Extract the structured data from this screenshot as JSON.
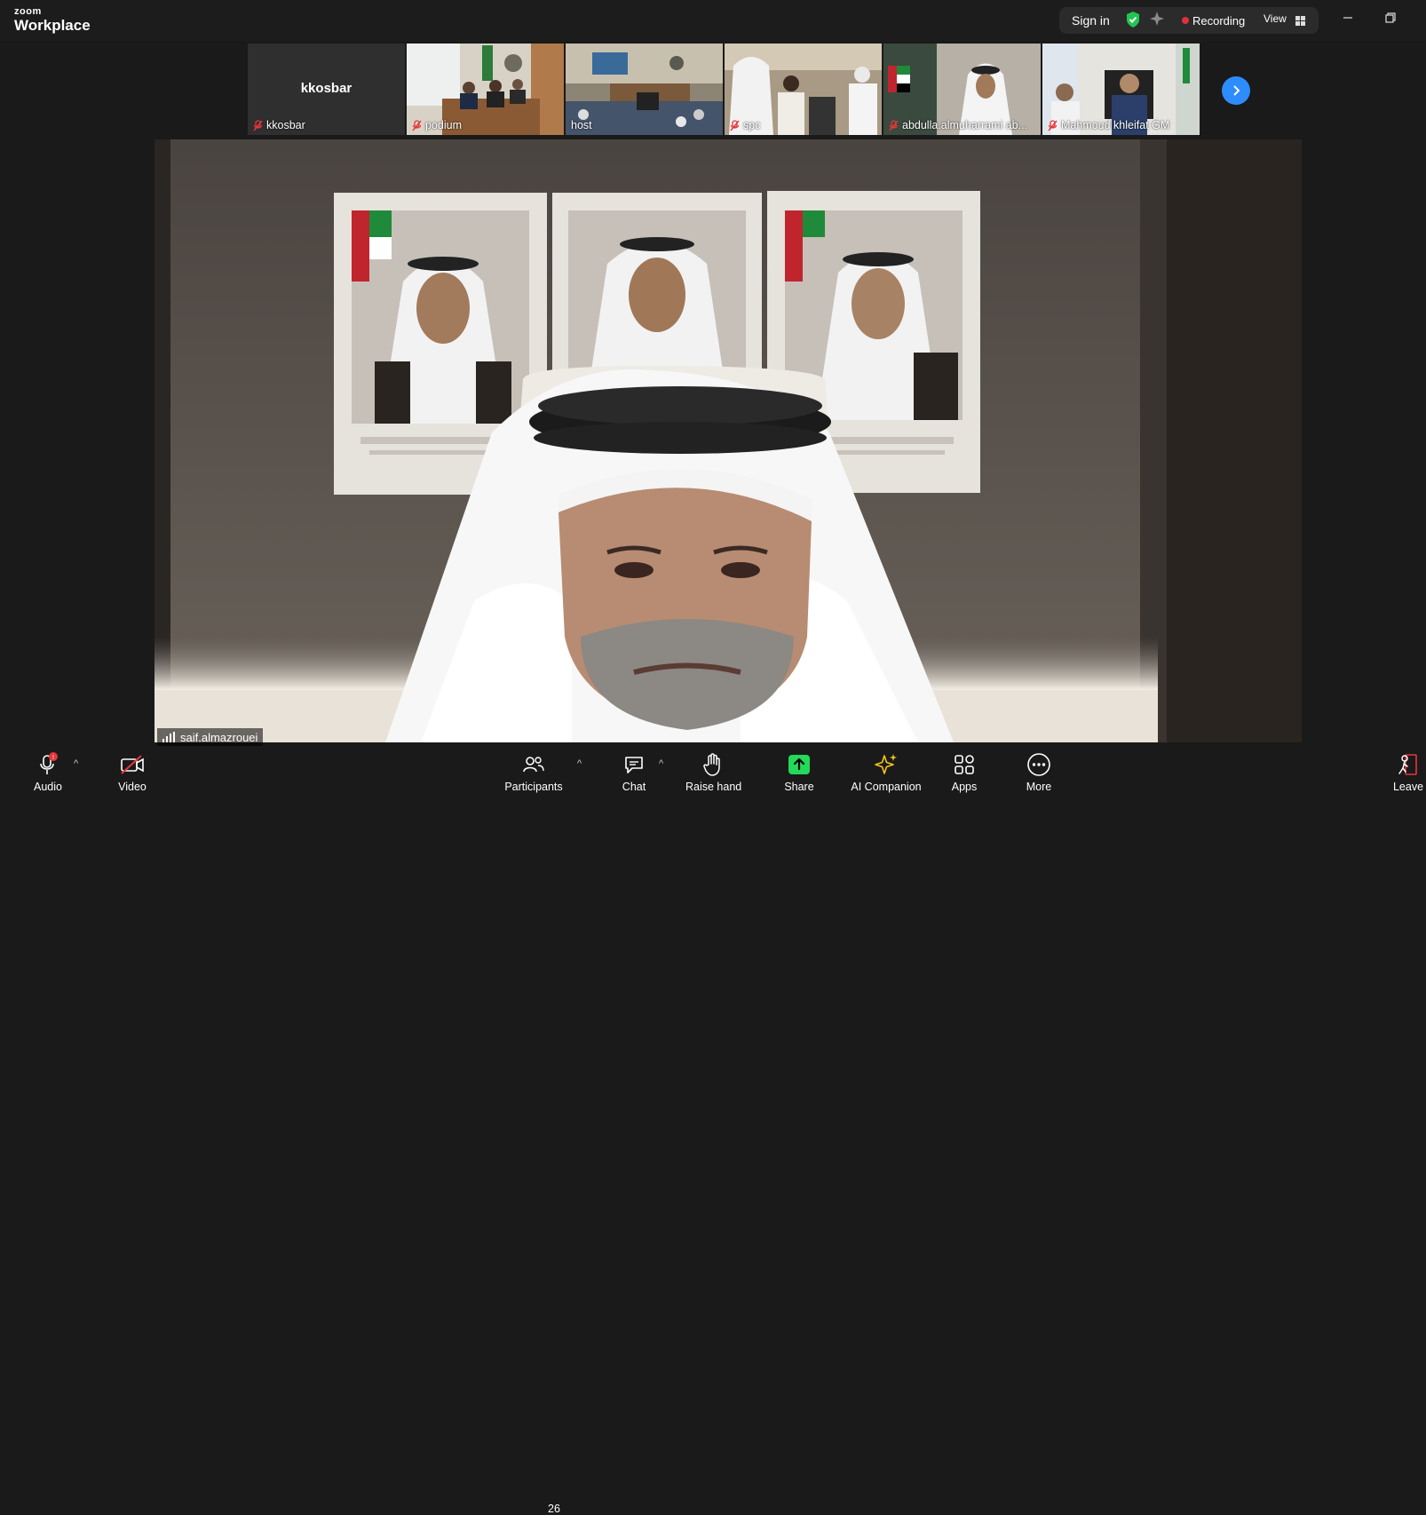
{
  "app": {
    "brand_small": "zoom",
    "brand_large": "Workplace"
  },
  "titlebar": {
    "sign_in": "Sign in",
    "recording": "Recording",
    "view": "View",
    "shield_icon": "shield-check-icon",
    "sparkle_icon": "sparkle-icon"
  },
  "thumbnails": [
    {
      "name": "kkosbar",
      "big_name": "kkosbar",
      "muted": true
    },
    {
      "name": "podium",
      "muted": true
    },
    {
      "name": "host",
      "muted": true
    },
    {
      "name": "spc",
      "muted": true
    },
    {
      "name": "abdulla.almuharrami ab...",
      "muted": true
    },
    {
      "name": "Mahmoud khleifat GM",
      "muted": true
    }
  ],
  "active_speaker": {
    "name": "saif.almazrouei"
  },
  "toolbar": {
    "audio": "Audio",
    "video": "Video",
    "participants": "Participants",
    "participants_count": "26",
    "chat": "Chat",
    "raise_hand": "Raise hand",
    "share": "Share",
    "ai_companion": "AI Companion",
    "apps": "Apps",
    "more": "More",
    "leave": "Leave"
  },
  "colors": {
    "accent": "#2d8cff",
    "share_green": "#23d959",
    "recording_red": "#e0303a",
    "muted_red": "#e5363c",
    "ai_yellow": "#f5c518"
  }
}
